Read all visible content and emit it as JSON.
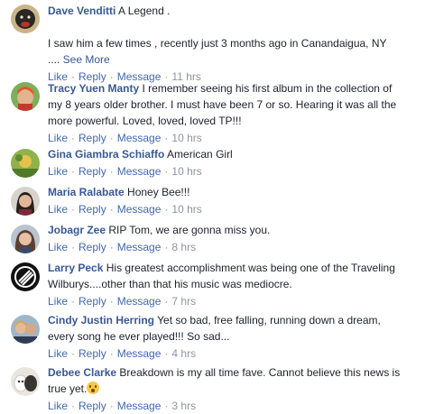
{
  "actions": {
    "like": "Like",
    "reply": "Reply",
    "message": "Message",
    "separator": "·"
  },
  "comments": [
    {
      "avatar_icon": "avatar-dog-photo",
      "author": "Dave Venditti",
      "lines": [
        "A Legend .",
        "",
        "I saw him a few times , recently just 3 months ago in Canandaigua, NY"
      ],
      "ellipsis": ".... ",
      "see_more": "See More",
      "time": "11 hrs"
    },
    {
      "avatar_icon": "avatar-woman-photo",
      "author": "Tracy Yuen Manty",
      "lines": [
        "I remember seeing his first album in the collection of",
        "my 8 years older brother. I must have been 7 or so. Hearing it was all the",
        "more powerful. Loved, loved, loved TP!!!"
      ],
      "time": "10 hrs"
    },
    {
      "avatar_icon": "avatar-landscape-photo",
      "author": "Gina Giambra Schiaffo",
      "lines": [
        "American Girl"
      ],
      "time": "10 hrs"
    },
    {
      "avatar_icon": "avatar-woman-photo",
      "author": "Maria Ralabate",
      "lines": [
        "Honey Bee!!!"
      ],
      "time": "10 hrs"
    },
    {
      "avatar_icon": "avatar-woman-photo",
      "author": "Jobagr Zee",
      "lines": [
        "RIP Tom, we are gonna miss you."
      ],
      "time": "8 hrs"
    },
    {
      "avatar_icon": "avatar-logo-black",
      "author": "Larry Peck",
      "lines": [
        "His greatest accomplishment was being one of the Traveling",
        "Wilburys....other than that his music was mediocre."
      ],
      "time": "7 hrs"
    },
    {
      "avatar_icon": "avatar-couple-photo",
      "author": "Cindy Justin Herring",
      "lines": [
        "Yet so bad, free falling, running down a dream,",
        "every song he ever played!!! So sad..."
      ],
      "time": "4 hrs"
    },
    {
      "avatar_icon": "avatar-dogs-photo",
      "author": "Debee Clarke",
      "lines": [
        "Breakdown is my all time fave. Cannot believe this news is",
        "true yet."
      ],
      "emoji_icon": "astonished-face-emoji",
      "time": "3 hrs"
    }
  ]
}
